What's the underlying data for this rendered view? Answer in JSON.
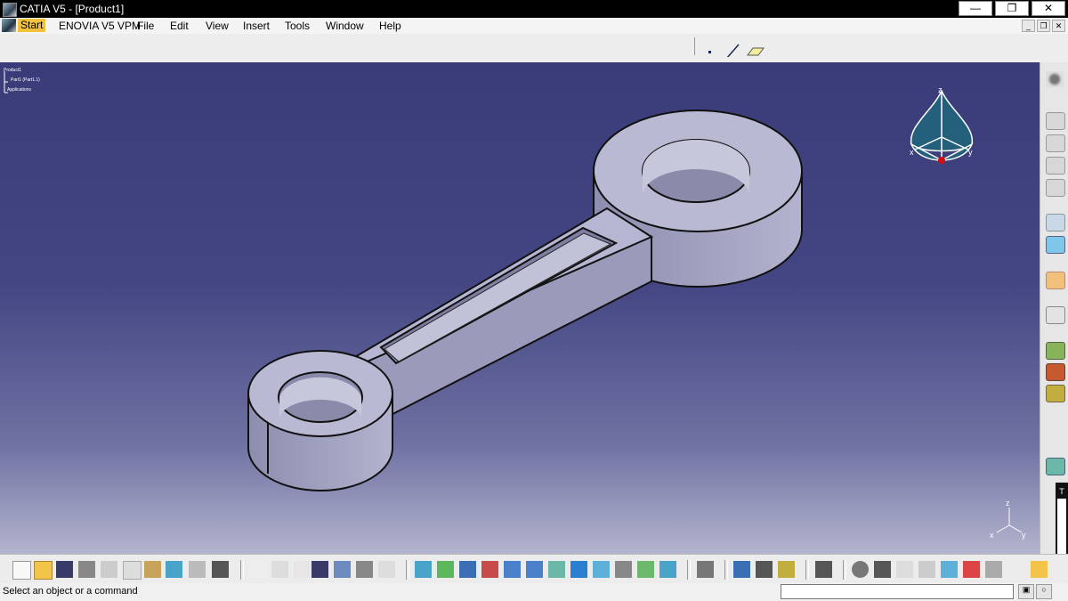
{
  "window": {
    "title": "CATIA V5 - [Product1]"
  },
  "menu": {
    "start": "Start",
    "items": [
      "ENOVIA V5 VPM",
      "File",
      "Edit",
      "View",
      "Insert",
      "Tools",
      "Window",
      "Help"
    ]
  },
  "tree": {
    "root": "Product1",
    "child": "Part1 (Part1.1)",
    "apps": "Applications"
  },
  "compass": {
    "x": "x",
    "y": "y",
    "z": "z"
  },
  "axis": {
    "x": "x",
    "y": "y",
    "z": "z"
  },
  "floating_toolbar": {
    "label": "T"
  },
  "status": {
    "message": "Select an object or a command"
  },
  "colors": {
    "accent_start": "#f3c13a",
    "viewport_top": "#3a3c79",
    "viewport_bottom": "#b3b4cd",
    "part_face": "#b9b9d3"
  }
}
